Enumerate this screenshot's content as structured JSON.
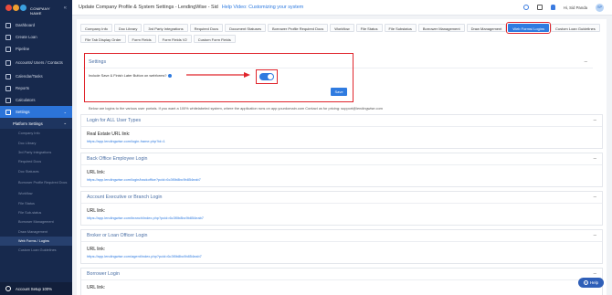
{
  "sidebar": {
    "brand": "COMPANY NAME",
    "items": [
      {
        "label": "Dashboard"
      },
      {
        "label": "Create Loan"
      },
      {
        "label": "Pipeline"
      },
      {
        "label": "Accounts/ Users / Contacts"
      },
      {
        "label": "Calendar/Tasks"
      },
      {
        "label": "Reports"
      },
      {
        "label": "Calculators"
      },
      {
        "label": "Settings"
      }
    ],
    "platform_settings": "Platform Settings",
    "sub_items": [
      {
        "label": "Company Info"
      },
      {
        "label": "Doc Library"
      },
      {
        "label": "3rd Party Integrations"
      },
      {
        "label": "Required Docs"
      },
      {
        "label": "Doc Statuses"
      },
      {
        "label": "Borrower Profile Required Docs"
      },
      {
        "label": "Workflow"
      },
      {
        "label": "File Status"
      },
      {
        "label": "File Sub-status"
      },
      {
        "label": "Borrower Management"
      },
      {
        "label": "Draw Management"
      },
      {
        "label": "Web Forms / Logins"
      },
      {
        "label": "Custom Loan Guidelines"
      }
    ],
    "account_setup": "Account Setup 100%"
  },
  "topbar": {
    "title": "Update Company Profile & System Settings - LendingWise - Sid",
    "help_link": "Help Video: Customizing your system",
    "user": "Hi, Sid Panda",
    "avatar": "SP"
  },
  "tabs": [
    {
      "label": "Company Info",
      "active": false
    },
    {
      "label": "Doc Library",
      "active": false
    },
    {
      "label": "3rd Party Integrations",
      "active": false
    },
    {
      "label": "Required Docs",
      "active": false
    },
    {
      "label": "Document Statuses",
      "active": false
    },
    {
      "label": "Borrower Profile Required Docs",
      "active": false
    },
    {
      "label": "Workflow",
      "active": false
    },
    {
      "label": "File Status",
      "active": false
    },
    {
      "label": "File Substatus",
      "active": false
    },
    {
      "label": "Borrower Management",
      "active": false
    },
    {
      "label": "Draw Management",
      "active": false
    },
    {
      "label": "Web Forms/ Logins",
      "active": true
    },
    {
      "label": "Custom Loan Guidelines",
      "active": false
    },
    {
      "label": "File Tab Display Order",
      "active": false
    },
    {
      "label": "Form Fields",
      "active": false
    },
    {
      "label": "Form Fields V2",
      "active": false
    },
    {
      "label": "Custom Form Fields",
      "active": false
    }
  ],
  "settings": {
    "heading": "Settings",
    "option_label": "Include Save & Finish Later Button on webforms?",
    "toggle_on": true,
    "save_label": "Save"
  },
  "note": "Below are logins to the various user portals. If you want a 100% whitelabeled system, where the application runs on app.yourdomain.com Contact us for pricing: support@lendingwise.com",
  "login_panels": [
    {
      "heading": "Login for ALL User Types",
      "label": "Real Estate URL link:",
      "url": "https://app.lendingwise.com/login-frame.php?id=1"
    },
    {
      "heading": "Back Office Employee Login",
      "label": "URL link:",
      "url": "https://app.lendingwise.com/login/backoffice?pcid=6c3f0b8bc9b854eab7"
    },
    {
      "heading": "Account Executive or Branch Login",
      "label": "URL link:",
      "url": "https://app.lendingwise.com/branch/index.php?pcid=6c3f0b8bc9b854eab7"
    },
    {
      "heading": "Broker or Loan Officer Login",
      "label": "URL link:",
      "url": "https://app.lendingwise.com/agent/index.php?pcid=6c3f0b8bc9b854eab7"
    },
    {
      "heading": "Borrower Login",
      "label": "URL link:",
      "url": ""
    }
  ],
  "help_button": "Help",
  "colors": {
    "accent": "#2f7be0",
    "sidebar": "#17294d",
    "highlight": "#e0242b"
  }
}
